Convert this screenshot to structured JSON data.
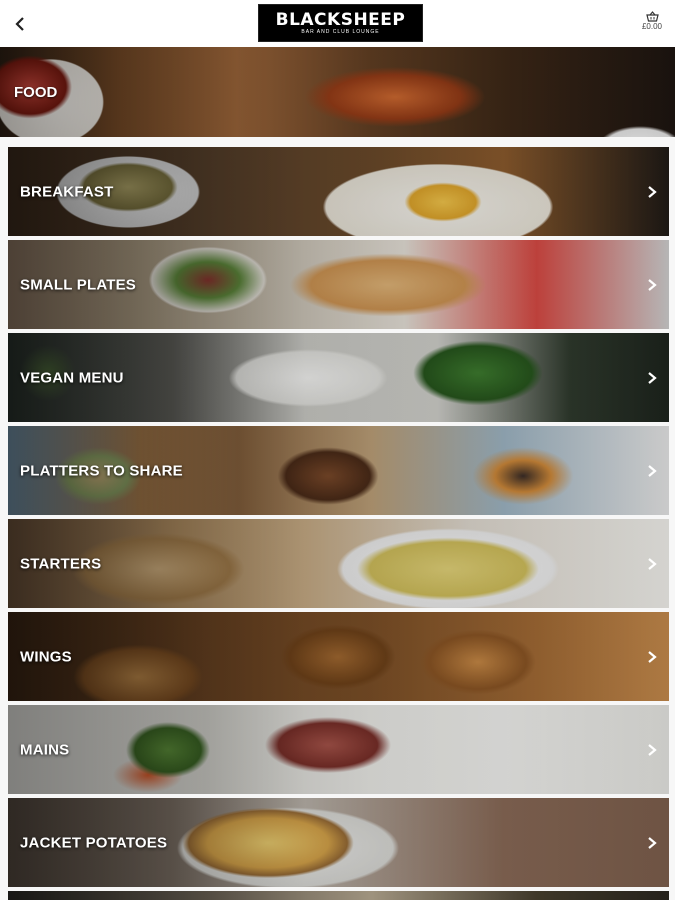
{
  "header": {
    "back_icon": "chevron-left-icon",
    "logo": {
      "main": "BLACKSHEEP",
      "sub": "BAR AND CLUB LOUNGE"
    },
    "basket": {
      "icon": "basket-icon",
      "total": "£0.00"
    }
  },
  "banner": {
    "title": "FOOD"
  },
  "categories": [
    {
      "label": "BREAKFAST"
    },
    {
      "label": "SMALL PLATES"
    },
    {
      "label": "VEGAN MENU"
    },
    {
      "label": "PLATTERS TO SHARE"
    },
    {
      "label": "STARTERS"
    },
    {
      "label": "WINGS"
    },
    {
      "label": "MAINS"
    },
    {
      "label": "JACKET POTATOES"
    }
  ],
  "colors": {
    "label_text": "#ffffff",
    "logo_bg": "#000000",
    "page_bg": "#ffffff"
  }
}
